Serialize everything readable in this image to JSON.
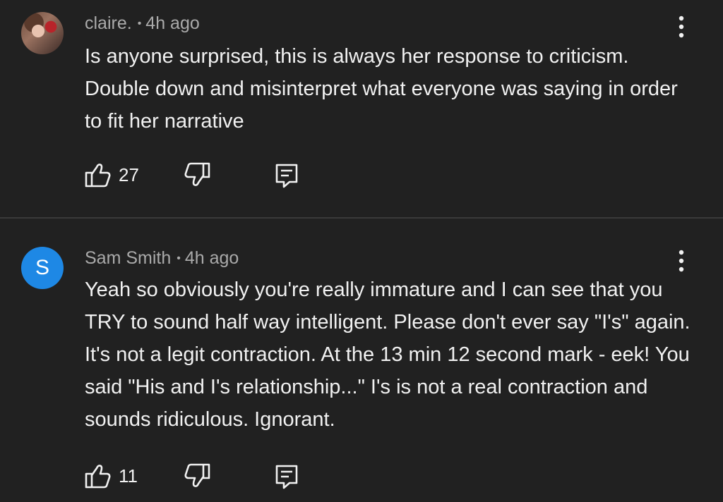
{
  "comments": [
    {
      "author": "claire.",
      "time": "4h ago",
      "avatar_letter": "",
      "text": "Is anyone surprised, this is always her response to criticism. Double down and misinterpret what everyone was saying in order to fit her narrative",
      "likes": "27"
    },
    {
      "author": "Sam Smith",
      "time": "4h ago",
      "avatar_letter": "S",
      "text": "Yeah so obviously you're really immature and I can see that you TRY to sound half way intelligent. Please don't ever say \"I's\" again. It's not a legit contraction. At the 13 min 12 second mark - eek! You said \"His and I's relationship...\" I's is not a real contraction and sounds ridiculous. Ignorant.",
      "likes": "11"
    }
  ],
  "separator": "•",
  "icons": {
    "like": "thumbs-up-icon",
    "dislike": "thumbs-down-icon",
    "reply": "reply-icon",
    "more": "more-vert-icon"
  },
  "colors": {
    "background": "#212121",
    "avatar_letter_bg": "#1e88e5",
    "meta_text": "#aaaaaa"
  }
}
